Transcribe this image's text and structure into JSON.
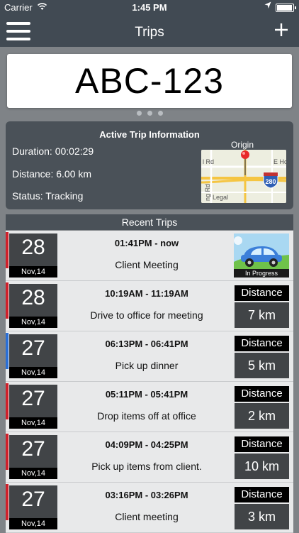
{
  "status_bar": {
    "carrier": "Carrier",
    "time": "1:45 PM"
  },
  "nav": {
    "title": "Trips"
  },
  "plate": {
    "text": "ABC-123"
  },
  "active_trip": {
    "header": "Active Trip Information",
    "duration": "Duration: 00:02:29",
    "distance": "Distance: 6.00 km",
    "status": "Status: Tracking",
    "origin_label": "Origin",
    "map_labels": {
      "rd": "l Rd",
      "eh": "E Ho",
      "ng": "ng Rd",
      "legal": "Legal",
      "hwy": "280"
    }
  },
  "recent": {
    "header": "Recent Trips",
    "trips": [
      {
        "day": "28",
        "month": "Nov,14",
        "times": "01:41PM - now",
        "desc": "Client Meeting",
        "in_progress": "In Progress",
        "bar_color": "#d0202a"
      },
      {
        "day": "28",
        "month": "Nov,14",
        "times": "10:19AM - 11:19AM",
        "desc": "Drive to office for meeting",
        "dist_label": "Distance",
        "dist": "7 km",
        "bar_color": "#d0202a"
      },
      {
        "day": "27",
        "month": "Nov,14",
        "times": "06:13PM - 06:41PM",
        "desc": "Pick up dinner",
        "dist_label": "Distance",
        "dist": "5 km",
        "bar_color": "#2a6fd6"
      },
      {
        "day": "27",
        "month": "Nov,14",
        "times": "05:11PM - 05:41PM",
        "desc": "Drop items off at office",
        "dist_label": "Distance",
        "dist": "2 km",
        "bar_color": "#d0202a"
      },
      {
        "day": "27",
        "month": "Nov,14",
        "times": "04:09PM - 04:25PM",
        "desc": "Pick up items from client.",
        "dist_label": "Distance",
        "dist": "10 km",
        "bar_color": "#d0202a"
      },
      {
        "day": "27",
        "month": "Nov,14",
        "times": "03:16PM - 03:26PM",
        "desc": "Client meeting",
        "dist_label": "Distance",
        "dist": "3 km",
        "bar_color": "#d0202a"
      }
    ]
  }
}
